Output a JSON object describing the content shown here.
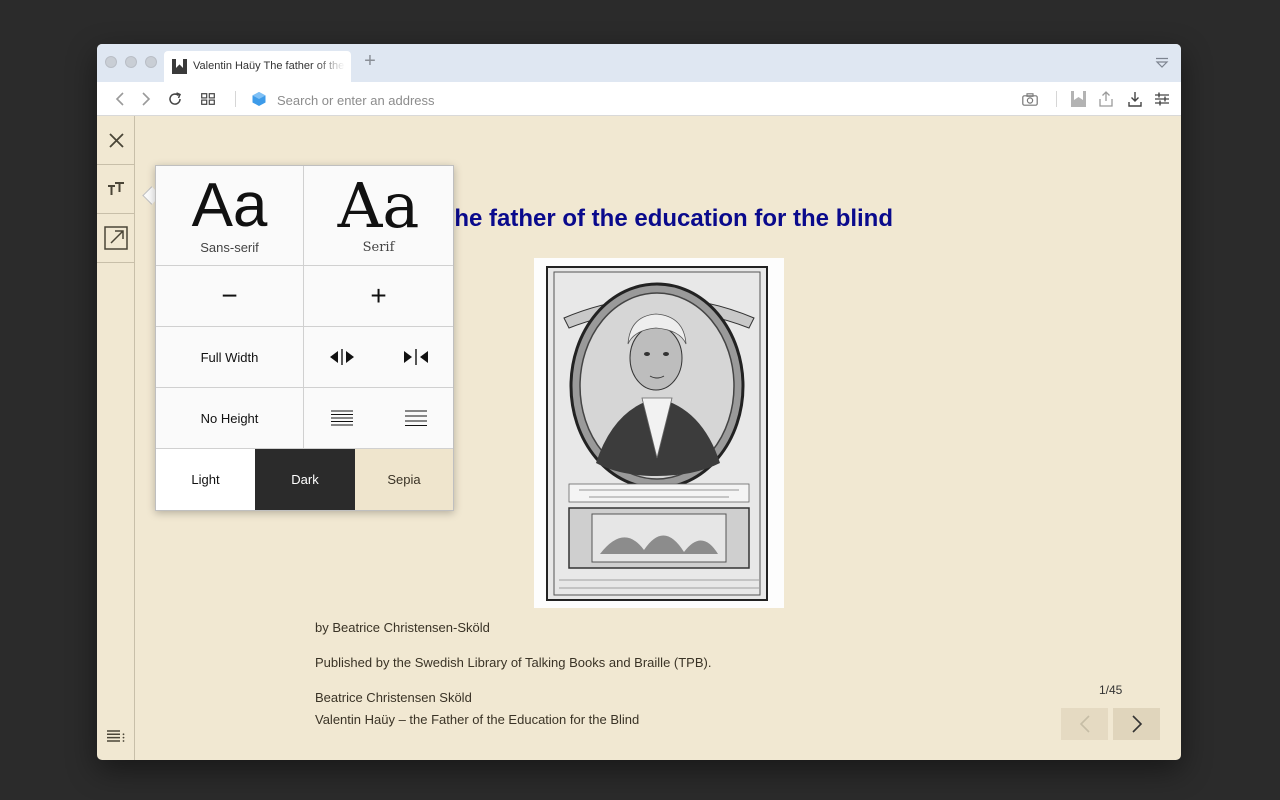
{
  "browser": {
    "tab_title": "Valentin Haüy The father of the education for the blind",
    "new_tab_symbol": "+",
    "address_placeholder": "Search or enter an address",
    "address_value": ""
  },
  "reader": {
    "title_visible": "ŭy The father of the education for the blind",
    "byline": "by Beatrice Christensen-Sköld",
    "published": "Published by the Swedish Library of Talking Books and Braille (TPB).",
    "author_name": "Beatrice Christensen Sköld",
    "book_title": "Valentin Haüy – the Father of the Education for the Blind",
    "page_counter": "1/45",
    "title_color": "#0a0a8c",
    "background_color": "#f1e8d2"
  },
  "settings": {
    "font_sans_sample": "Aa",
    "font_sans_label": "Sans-serif",
    "font_serif_sample": "Aa",
    "font_serif_label": "Serif",
    "decrease_symbol": "−",
    "increase_symbol": "+",
    "full_width_label": "Full Width",
    "no_height_label": "No Height",
    "theme_light_label": "Light",
    "theme_dark_label": "Dark",
    "theme_sepia_label": "Sepia"
  },
  "icons": {
    "sidebar": [
      "close-icon",
      "text-size-icon",
      "open-external-icon",
      "contents-list-icon"
    ],
    "toolbar": [
      "back-icon",
      "forward-icon",
      "reload-icon",
      "tab-grid-icon",
      "site-icon",
      "camera-icon",
      "reader-view-icon",
      "share-icon",
      "download-icon",
      "settings-sliders-icon"
    ]
  }
}
